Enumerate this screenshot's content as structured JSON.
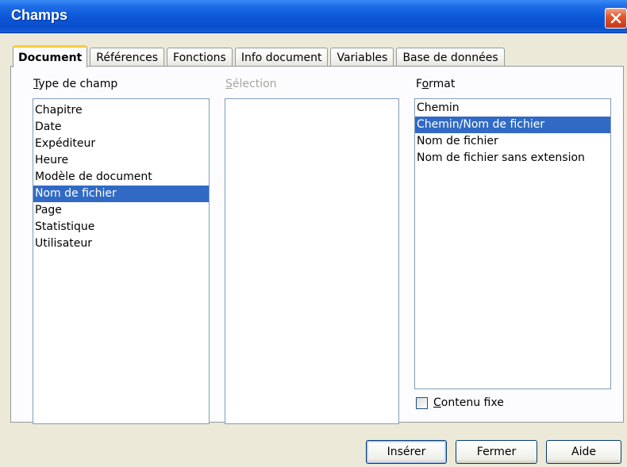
{
  "window": {
    "title": "Champs"
  },
  "tabs": [
    {
      "label": "Document",
      "active": true
    },
    {
      "label": "Références",
      "active": false
    },
    {
      "label": "Fonctions",
      "active": false
    },
    {
      "label": "Info document",
      "active": false
    },
    {
      "label": "Variables",
      "active": false
    },
    {
      "label": "Base de données",
      "active": false
    }
  ],
  "type_champ": {
    "label_ul": "T",
    "label_rest": "ype de champ",
    "items": [
      "Chapitre",
      "Date",
      "Expéditeur",
      "Heure",
      "Modèle de document",
      "Nom de fichier",
      "Page",
      "Statistique",
      "Utilisateur"
    ],
    "selected": "Nom de fichier"
  },
  "selection": {
    "label_ul": "S",
    "label_rest": "élection",
    "items": []
  },
  "format": {
    "label_pre": "F",
    "label_ul": "o",
    "label_rest": "rmat",
    "items": [
      "Chemin",
      "Chemin/Nom de fichier",
      "Nom de fichier",
      "Nom de fichier sans extension"
    ],
    "selected": "Chemin/Nom de fichier"
  },
  "contenu_fixe": {
    "label_ul": "C",
    "label_rest": "ontenu fixe",
    "checked": false
  },
  "buttons": {
    "insert": "Insérer",
    "close": "Fermer",
    "help": "Aide"
  },
  "colors": {
    "title_bar": "#0a55d6",
    "selection": "#316ac5",
    "tab_highlight": "#ffc83c",
    "close_button": "#e2572d"
  }
}
